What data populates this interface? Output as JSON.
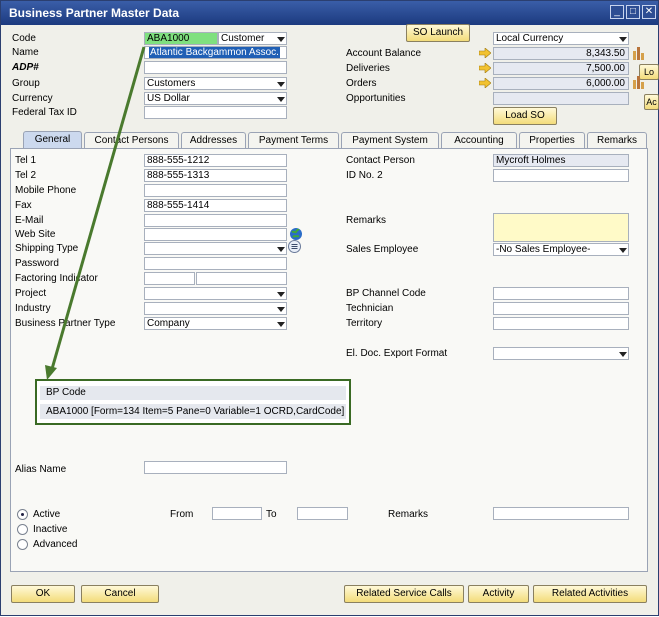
{
  "window": {
    "title": "Business Partner Master Data"
  },
  "header": {
    "code_label": "Code",
    "code_value": "ABA1000",
    "type_value": "Customer",
    "name_label": "Name",
    "name_value": "Atlantic Backgammon Assoc.",
    "adp_label": "ADP#",
    "group_label": "Group",
    "group_value": "Customers",
    "currency_label": "Currency",
    "currency_value": "US Dollar",
    "taxid_label": "Federal Tax ID",
    "so_launch": "SO Launch",
    "load_so": "Load SO",
    "local_currency": "Local Currency",
    "account_balance_label": "Account Balance",
    "account_balance_value": "8,343.50",
    "deliveries_label": "Deliveries",
    "deliveries_value": "7,500.00",
    "orders_label": "Orders",
    "orders_value": "6,000.00",
    "opportunities_label": "Opportunities",
    "edge_lo": "Lo",
    "edge_ac": "Ac"
  },
  "tabs": [
    "General",
    "Contact Persons",
    "Addresses",
    "Payment Terms",
    "Payment System",
    "Accounting",
    "Properties",
    "Remarks"
  ],
  "general": {
    "tel1_label": "Tel 1",
    "tel1_value": "888-555-1212",
    "tel2_label": "Tel 2",
    "tel2_value": "888-555-1313",
    "mobile_label": "Mobile Phone",
    "fax_label": "Fax",
    "fax_value": "888-555-1414",
    "email_label": "E-Mail",
    "website_label": "Web Site",
    "shipping_label": "Shipping Type",
    "password_label": "Password",
    "factoring_label": "Factoring Indicator",
    "project_label": "Project",
    "industry_label": "Industry",
    "bptype_label": "Business Partner Type",
    "bptype_value": "Company",
    "contact_label": "Contact Person",
    "contact_value": "Mycroft Holmes",
    "idno2_label": "ID No. 2",
    "remarks_label": "Remarks",
    "sales_emp_label": "Sales Employee",
    "sales_emp_value": "-No Sales Employee-",
    "channel_label": "BP Channel Code",
    "technician_label": "Technician",
    "territory_label": "Territory",
    "eldoc_label": "El. Doc. Export Format",
    "alias_label": "Alias Name",
    "active_label": "Active",
    "inactive_label": "Inactive",
    "advanced_label": "Advanced",
    "from_label": "From",
    "to_label": "To",
    "remarks2_label": "Remarks"
  },
  "tooltip": {
    "header": "BP Code",
    "body": "ABA1000 [Form=134 Item=5 Pane=0 Variable=1 OCRD,CardCode]"
  },
  "footer": {
    "ok": "OK",
    "cancel": "Cancel",
    "related_service_calls": "Related Service Calls",
    "activity": "Activity",
    "related_activities": "Related Activities"
  },
  "colors": {
    "titlebar": "#1c3a7f",
    "code_highlight": "#7fe07f",
    "name_highlight": "#1f5fb5",
    "arrow": "#4a7a2e",
    "remarks_bg": "#fffac8",
    "button": "#f3dc7a"
  }
}
